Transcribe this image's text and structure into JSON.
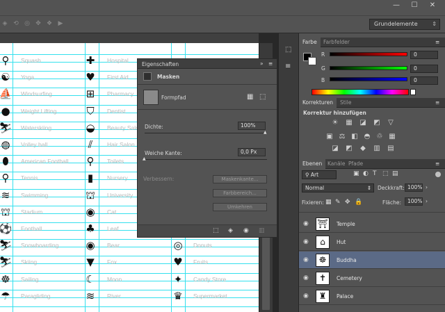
{
  "window": {
    "minimize": "—",
    "restore": "☐",
    "close": "✕"
  },
  "options_bar": {
    "workspace": "Grundelemente"
  },
  "canvas": {
    "columns": [
      {
        "items": [
          {
            "label": "Squash",
            "icon": "squash-racket-icon",
            "glyph": "⚲"
          },
          {
            "label": "Yoga",
            "icon": "yoga-icon",
            "glyph": "☯"
          },
          {
            "label": "Windsurfing",
            "icon": "windsurfing-icon",
            "glyph": "⛵"
          },
          {
            "label": "Weight Lifting",
            "icon": "kettlebell-icon",
            "glyph": "●"
          },
          {
            "label": "Waterskiing",
            "icon": "waterskiing-icon",
            "glyph": "⛷"
          },
          {
            "label": "Volley ball",
            "icon": "volleyball-icon",
            "glyph": "◍"
          },
          {
            "label": "American Football",
            "icon": "american-football-icon",
            "glyph": "⬮"
          },
          {
            "label": "Tennis",
            "icon": "tennis-icon",
            "glyph": "⚲"
          },
          {
            "label": "Swimming",
            "icon": "swimming-icon",
            "glyph": "≋"
          },
          {
            "label": "Stadium",
            "icon": "stadium-icon",
            "glyph": "⛫"
          },
          {
            "label": "Football",
            "icon": "football-icon",
            "glyph": "⚽"
          },
          {
            "label": "Snowboarding",
            "icon": "snowboarding-icon",
            "glyph": "⛷"
          },
          {
            "label": "Skiing",
            "icon": "skiing-icon",
            "glyph": "⛷"
          },
          {
            "label": "Sailing",
            "icon": "ship-wheel-icon",
            "glyph": "☸"
          },
          {
            "label": "Paragliding",
            "icon": "paragliding-icon",
            "glyph": "☂"
          }
        ]
      },
      {
        "items": [
          {
            "label": "Hospital",
            "icon": "hospital-cross-icon",
            "glyph": "✚"
          },
          {
            "label": "First Aid",
            "icon": "first-aid-heart-icon",
            "glyph": "♥"
          },
          {
            "label": "Pharmacy",
            "icon": "pharmacy-icon",
            "glyph": "⊞"
          },
          {
            "label": "Dentist",
            "icon": "tooth-icon",
            "glyph": "⛉"
          },
          {
            "label": "Beauty Salon",
            "icon": "lips-icon",
            "glyph": "◒"
          },
          {
            "label": "Hair Salon",
            "icon": "comb-icon",
            "glyph": "⫽"
          },
          {
            "label": "Toilets",
            "icon": "toilet-icon",
            "glyph": "⚲"
          },
          {
            "label": "Nursery",
            "icon": "baby-bottle-icon",
            "glyph": "▮"
          },
          {
            "label": "University",
            "icon": "graduation-cap-icon",
            "glyph": "⛫"
          },
          {
            "label": "Cat",
            "icon": "cat-icon",
            "glyph": "◉"
          },
          {
            "label": "Leaf",
            "icon": "leaf-icon",
            "glyph": "♣"
          },
          {
            "label": "Bear",
            "icon": "bear-icon",
            "glyph": "◉"
          },
          {
            "label": "Fox",
            "icon": "fox-icon",
            "glyph": "▼"
          },
          {
            "label": "Moon",
            "icon": "moon-icon",
            "glyph": "☾"
          },
          {
            "label": "River",
            "icon": "river-icon",
            "glyph": "≋"
          }
        ]
      },
      {
        "items": [
          {
            "label": "Donuts",
            "icon": "donut-icon",
            "glyph": "◎",
            "row": 11
          },
          {
            "label": "Fruits",
            "icon": "strawberry-icon",
            "glyph": "♥",
            "row": 12
          },
          {
            "label": "Candy Store",
            "icon": "candy-icon",
            "glyph": "✦",
            "row": 13
          },
          {
            "label": "Supermarket",
            "icon": "cupcake-icon",
            "glyph": "♛",
            "row": 14
          }
        ]
      }
    ]
  },
  "properties_panel": {
    "title": "Eigenschaften",
    "section": "Masken",
    "mask_type": "Formpfad",
    "density_label": "Dichte:",
    "density_value": "100%",
    "feather_label": "Weiche Kante:",
    "feather_value": "0,0 Px",
    "refine_label": "Verbessern:",
    "refine_buttons": [
      "Maskenkante...",
      "Farbbereich...",
      "Umkehren"
    ]
  },
  "color_panel": {
    "tabs": [
      "Farbe",
      "Farbfelder"
    ],
    "channels": [
      {
        "name": "R",
        "value": "0",
        "color": "#ff0000"
      },
      {
        "name": "G",
        "value": "0",
        "color": "#00ff00"
      },
      {
        "name": "B",
        "value": "0",
        "color": "#0000ff"
      }
    ]
  },
  "adjustments_panel": {
    "tabs": [
      "Korrekturen",
      "Stile"
    ],
    "heading": "Korrektur hinzufügen",
    "row1": [
      "☀",
      "▦",
      "◪",
      "◩",
      "▽"
    ],
    "row2": [
      "▣",
      "⚖",
      "◧",
      "◓",
      "♲",
      "▦"
    ],
    "row3": [
      "◪",
      "◩",
      "◆",
      "▥",
      "▤"
    ]
  },
  "layers_panel": {
    "tabs": [
      "Ebenen",
      "Kanäle",
      "Pfade"
    ],
    "filter": "Art",
    "blend_mode": "Normal",
    "opacity_label": "Deckkraft:",
    "opacity_value": "100%",
    "lock_label": "Fixieren:",
    "fill_label": "Fläche:",
    "fill_value": "100%",
    "layers": [
      {
        "name": "Temple",
        "icon": "temple-icon",
        "glyph": "⛩",
        "selected": false
      },
      {
        "name": "Hut",
        "icon": "hut-icon",
        "glyph": "⌂",
        "selected": false
      },
      {
        "name": "Buddha",
        "icon": "buddha-icon",
        "glyph": "☸",
        "selected": true
      },
      {
        "name": "Cemetery",
        "icon": "cemetery-cross-icon",
        "glyph": "✝",
        "selected": false
      },
      {
        "name": "Palace",
        "icon": "palace-icon",
        "glyph": "♜",
        "selected": false
      }
    ]
  }
}
